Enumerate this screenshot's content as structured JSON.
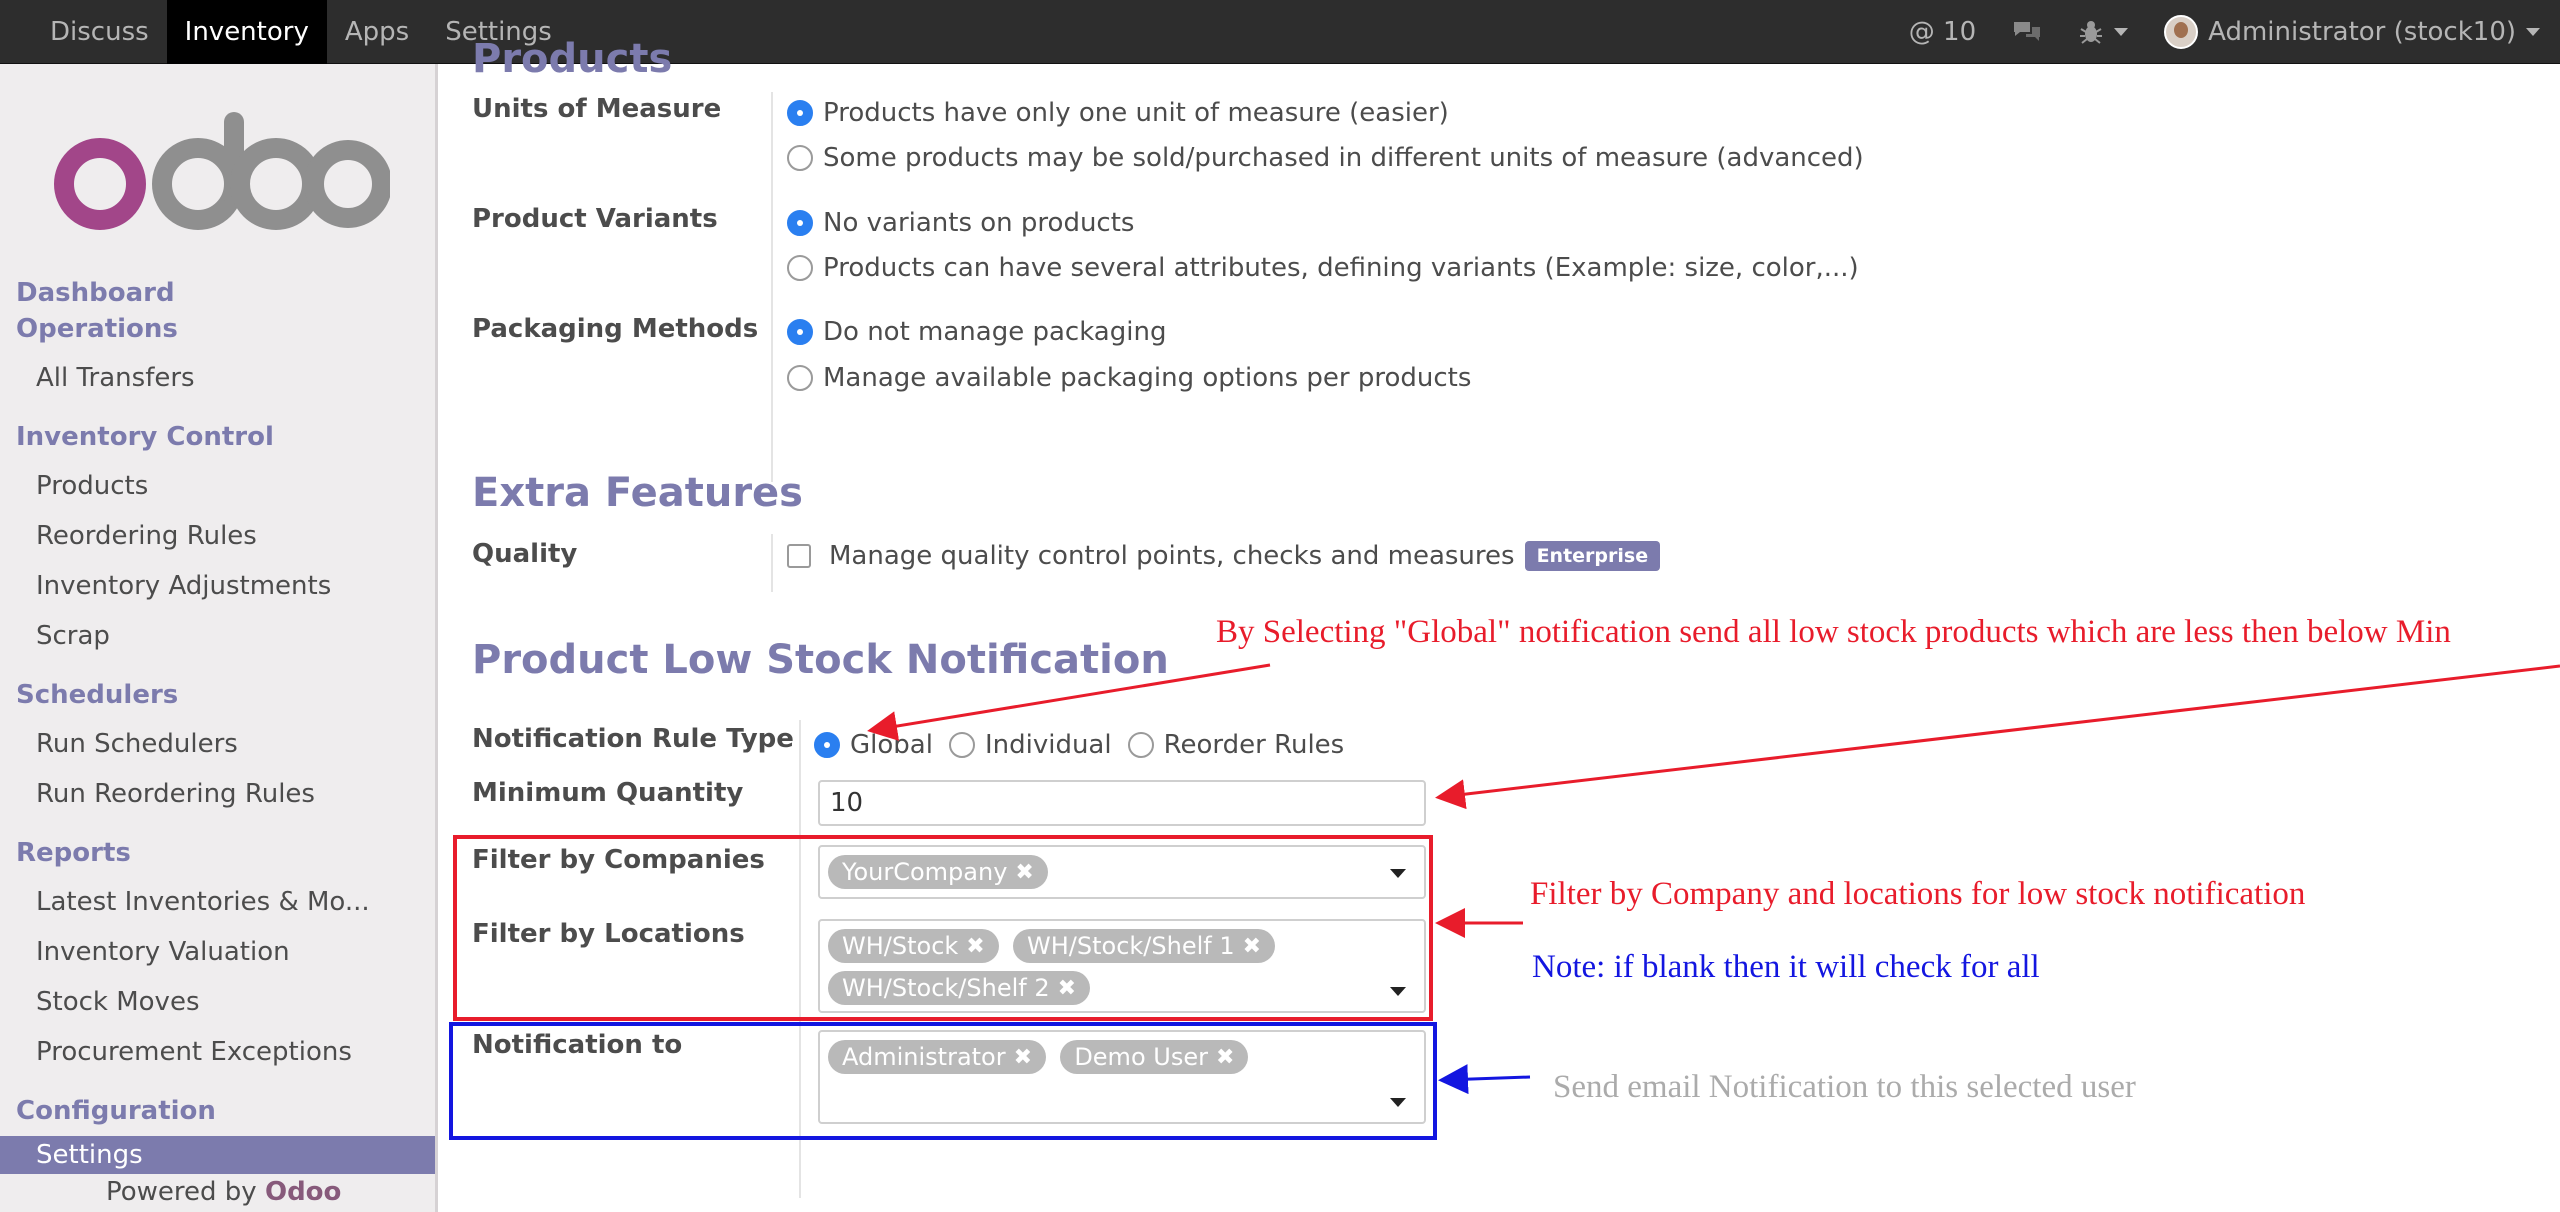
{
  "topbar": {
    "menu": [
      "Discuss",
      "Inventory",
      "Apps",
      "Settings"
    ],
    "mentions": "10",
    "user": "Administrator (stock10)"
  },
  "sidebar": {
    "logo_text": "odoo",
    "sections": {
      "dashboard": "Dashboard",
      "operations": "Operations",
      "inventory_control": "Inventory Control",
      "schedulers": "Schedulers",
      "reports": "Reports",
      "configuration": "Configuration"
    },
    "items": {
      "all_transfers": "All Transfers",
      "products": "Products",
      "reordering_rules": "Reordering Rules",
      "inventory_adjustments": "Inventory Adjustments",
      "scrap": "Scrap",
      "run_schedulers": "Run Schedulers",
      "run_reordering_rules": "Run Reordering Rules",
      "latest_inventories": "Latest Inventories & Mo...",
      "inventory_valuation": "Inventory Valuation",
      "stock_moves": "Stock Moves",
      "procurement_exceptions": "Procurement Exceptions",
      "settings": "Settings"
    },
    "powered_by": "Powered by",
    "powered_brand": "Odoo"
  },
  "products": {
    "heading": "Products",
    "uom_label": "Units of Measure",
    "uom_opt1": "Products have only one unit of measure (easier)",
    "uom_opt2": "Some products may be sold/purchased in different units of measure (advanced)",
    "variants_label": "Product Variants",
    "variants_opt1": "No variants on products",
    "variants_opt2": "Products can have several attributes, defining variants (Example: size, color,...)",
    "packaging_label": "Packaging Methods",
    "packaging_opt1": "Do not manage packaging",
    "packaging_opt2": "Manage available packaging options per products"
  },
  "extra": {
    "heading": "Extra Features",
    "quality_label": "Quality",
    "quality_text": "Manage quality control points, checks and measures",
    "quality_badge": "Enterprise"
  },
  "notification": {
    "heading": "Product Low Stock Notification",
    "rule_type_label": "Notification Rule Type",
    "rule_global": "Global",
    "rule_individual": "Individual",
    "rule_reorder": "Reorder Rules",
    "min_qty_label": "Minimum Quantity",
    "min_qty_value": "10",
    "companies_label": "Filter by Companies",
    "companies": [
      "YourCompany"
    ],
    "locations_label": "Filter by Locations",
    "locations": [
      "WH/Stock",
      "WH/Stock/Shelf 1",
      "WH/Stock/Shelf 2"
    ],
    "notify_label": "Notification to",
    "users": [
      "Administrator",
      "Demo User"
    ]
  },
  "annotations": {
    "global_note": "By Selecting \"Global\" notification send all low stock products which are less then below Min",
    "filter_note": "Filter by Company and locations for low stock notification",
    "blank_note": "Note: if blank then it will check for all",
    "email_note": "Send email Notification to this selected user"
  },
  "colors": {
    "accent": "#7c7bad",
    "radio_on": "#2a7ff0",
    "annot_red": "#e81c2b",
    "annot_blue": "#1316e0"
  }
}
